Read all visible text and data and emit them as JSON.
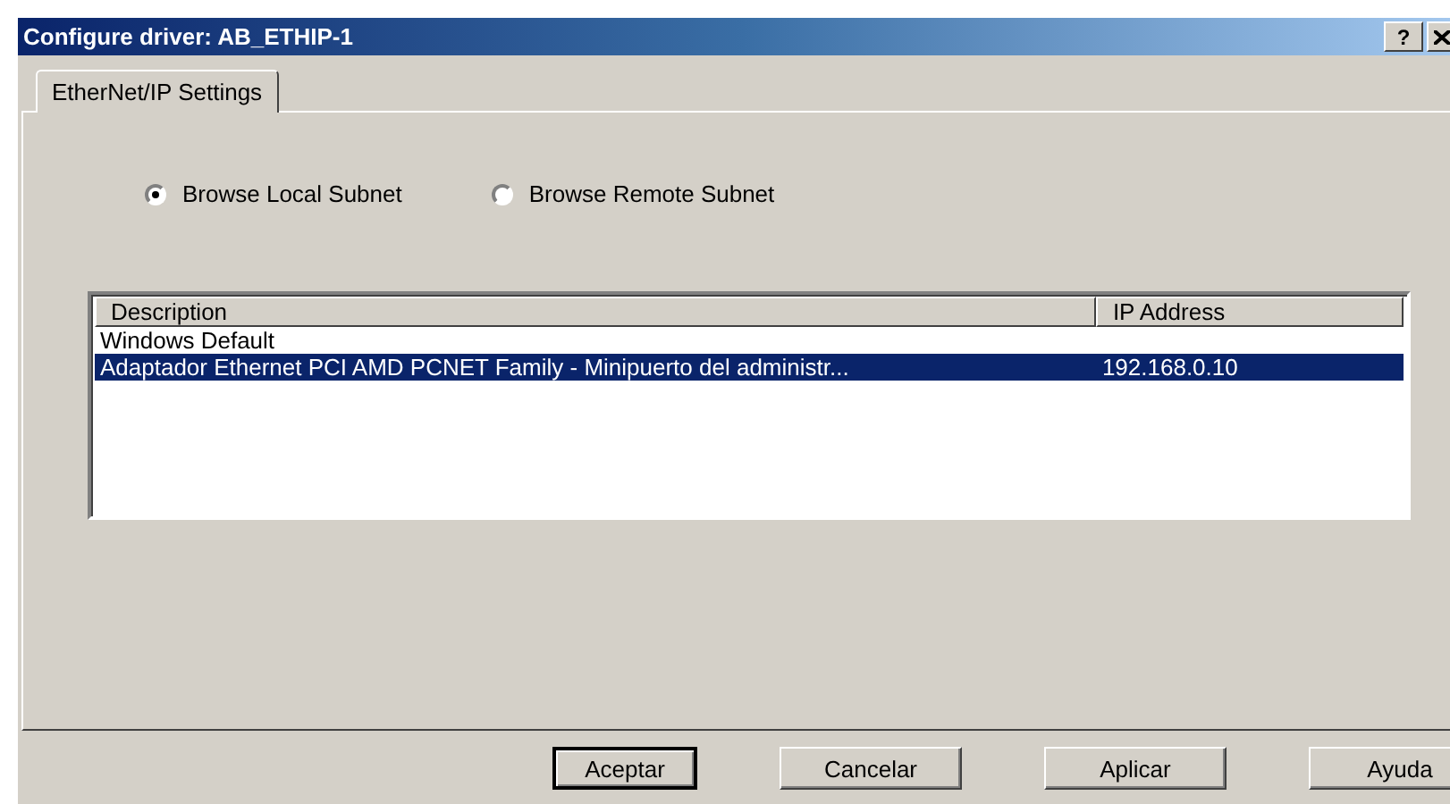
{
  "window": {
    "title": "Configure driver: AB_ETHIP-1",
    "help": "?"
  },
  "tabs": [
    {
      "label": "EtherNet/IP Settings",
      "selected": true
    }
  ],
  "radios": [
    {
      "label": "Browse Local Subnet",
      "selected": true
    },
    {
      "label": "Browse Remote Subnet",
      "selected": false
    }
  ],
  "table": {
    "columns": [
      "Description",
      "IP Address"
    ],
    "rows": [
      {
        "cells": [
          "Windows Default",
          ""
        ],
        "selected": false
      },
      {
        "cells": [
          "Adaptador Ethernet PCI AMD PCNET Family - Minipuerto del administr...",
          "192.168.0.10"
        ],
        "selected": true
      }
    ]
  },
  "buttons": [
    {
      "label": "Aceptar",
      "default": true
    },
    {
      "label": "Cancelar",
      "default": false
    },
    {
      "label": "Aplicar",
      "default": false
    },
    {
      "label": "Ayuda",
      "default": false
    }
  ]
}
